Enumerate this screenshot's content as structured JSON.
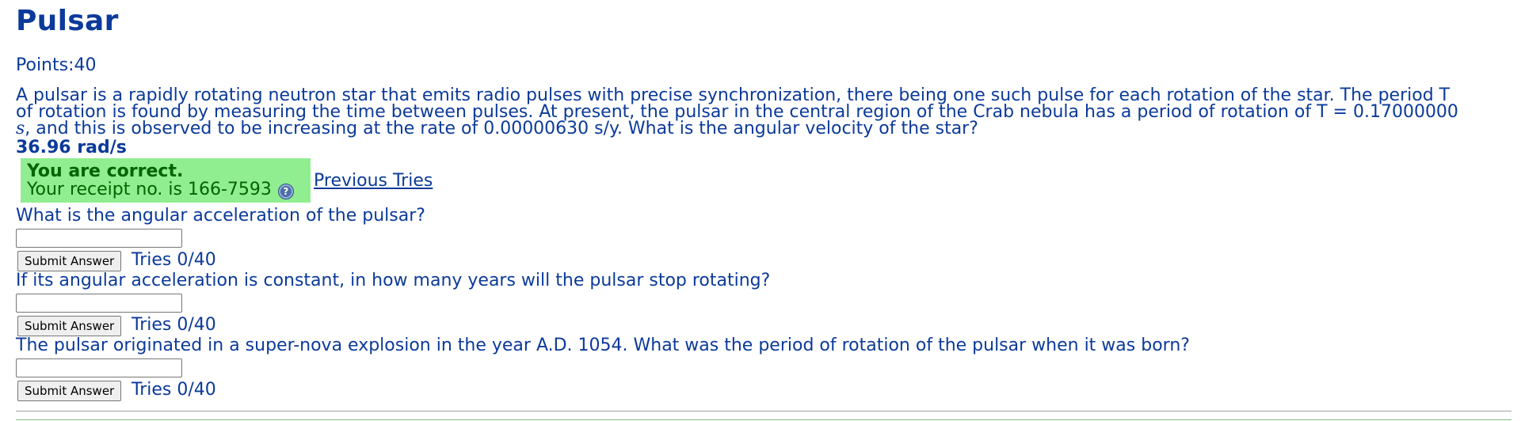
{
  "title": "Pulsar",
  "points": "Points:40",
  "problem": {
    "line1": "A pulsar is a rapidly rotating neutron star that emits radio pulses with precise synchronization, there being one such pulse for each rotation of the star. The period T",
    "line2": "of rotation is found by measuring the time between pulses. At present, the pulsar in the central region of the Crab nebula has a period of rotation of T = 0.17000000",
    "line3_symbol": "s",
    "line3_rest": ", and this is observed to be increasing at the rate of 0.00000630 s/y. What is the angular velocity of the star?"
  },
  "answer_value": "36.96 rad/s",
  "feedback": {
    "correct_title": "You are correct.",
    "receipt": "Your receipt no. is 166-7593",
    "help_icon": "help-question-icon",
    "color_bg": "#90ee90",
    "color_text": "#006400"
  },
  "previous_tries": "Previous Tries",
  "questions": [
    {
      "text": "What is the angular acceleration of the pulsar?",
      "input_value": "",
      "submit_label": "Submit Answer",
      "tries": "Tries 0/40"
    },
    {
      "text": "If its angular acceleration is constant, in how many years will the pulsar stop rotating?",
      "input_value": "",
      "submit_label": "Submit Answer",
      "tries": "Tries 0/40"
    },
    {
      "text": "The pulsar originated in a super-nova explosion in the year A.D. 1054. What was the period of rotation of the pulsar when it was born?",
      "input_value": "",
      "submit_label": "Submit Answer",
      "tries": "Tries 0/40"
    }
  ],
  "colors": {
    "text": "#0b3a9a",
    "divider": "#a0a0a0"
  }
}
